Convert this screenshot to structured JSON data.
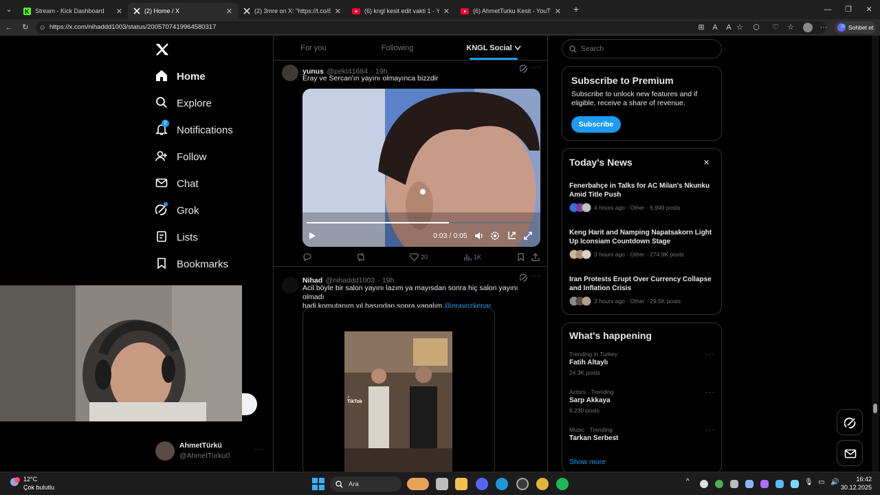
{
  "browser": {
    "tabs": [
      {
        "title": "Stream - Kick Dashboard",
        "color": "#53fc18",
        "icon": "kick-icon"
      },
      {
        "title": "(2) Home / X",
        "color": "#ffffff",
        "icon": "x-logo-icon"
      },
      {
        "title": "(2) 3mre on X: \"https://t.co/63FSsC",
        "color": "#ffffff",
        "icon": "x-logo-icon"
      },
      {
        "title": "(6) kngl kesit edit vakti 1 - YouTube",
        "color": "#ff0033",
        "icon": "youtube-icon"
      },
      {
        "title": "(6) AhmetTurku Kesit - YouTube",
        "color": "#ff0033",
        "icon": "youtube-icon"
      }
    ],
    "url": "https://x.com/nihaddd1003/status/2005707419964580317",
    "copilot_label": "Sohbet et"
  },
  "sidebar": {
    "items": [
      {
        "label": "Home",
        "icon": "home-icon"
      },
      {
        "label": "Explore",
        "icon": "search-icon"
      },
      {
        "label": "Notifications",
        "icon": "bell-icon",
        "badge": "2"
      },
      {
        "label": "Follow",
        "icon": "follow-icon"
      },
      {
        "label": "Chat",
        "icon": "mail-icon"
      },
      {
        "label": "Grok",
        "icon": "grok-icon"
      },
      {
        "label": "Lists",
        "icon": "lists-icon"
      },
      {
        "label": "Bookmarks",
        "icon": "bookmark-icon"
      }
    ],
    "account": {
      "name": "AhmetTürkü",
      "handle": "@AhmetTurku0"
    }
  },
  "feed": {
    "tabs": [
      "For you",
      "Following",
      "KNGL Social"
    ],
    "active_tab": "KNGL Social",
    "posts": [
      {
        "name": "yunus",
        "handle": "@pekt41684",
        "time": "· 19h",
        "text": "Eray ve Sercan'ın yayını olmayınca bizzdir",
        "video_time": "0:03 / 0:05",
        "progress": 0.62,
        "likes": "20",
        "views": "1K"
      },
      {
        "name": "Nihad",
        "handle": "@nihaddd1003",
        "time": "· 19h",
        "text_line1": "Acil böyle bir salon yayını lazım ya mayısdan sonra hiç salon yayını olmadı",
        "text_line2": "hadi komutanım yıl başından sonra yapalım",
        "mention": "@erayozkenar",
        "watermark": "TikTok"
      }
    ]
  },
  "right": {
    "search_placeholder": "Search",
    "premium": {
      "title": "Subscribe to Premium",
      "body": "Subscribe to unlock new features and if eligible, receive a share of revenue.",
      "button": "Subscribe"
    },
    "news": {
      "title": "Today's News",
      "items": [
        {
          "title": "Fenerbahçe in Talks for AC Milan's Nkunku Amid Title Push",
          "meta": "4 hours ago · Other · 6,949 posts"
        },
        {
          "title": "Keng Harit and Namping Napatsakorn Light Up Iconsiam Countdown Stage",
          "meta": "3 hours ago · Other · 274.9K posts"
        },
        {
          "title": "Iran Protests Erupt Over Currency Collapse and Inflation Crisis",
          "meta": "3 hours ago · Other · 29.5K posts"
        }
      ]
    },
    "happening": {
      "title": "What's happening",
      "trends": [
        {
          "context": "Trending in Turkey",
          "name": "Fatih Altaylı",
          "count": "24.3K posts"
        },
        {
          "context": "Actors · Trending",
          "name": "Sarp Akkaya",
          "count": "8,230 posts"
        },
        {
          "context": "Music · Trending",
          "name": "Tarkan Serbest",
          "count": ""
        }
      ],
      "show_more": "Show more"
    }
  },
  "taskbar": {
    "weather_temp": "12°C",
    "weather_desc": "Çok bulutlu",
    "search_label": "Ara",
    "time": "16:42",
    "date": "30.12.2025"
  },
  "colors": {
    "accent": "#1d9bf0",
    "x_bg": "#000000",
    "border": "#2f3336",
    "muted": "#71767b"
  }
}
